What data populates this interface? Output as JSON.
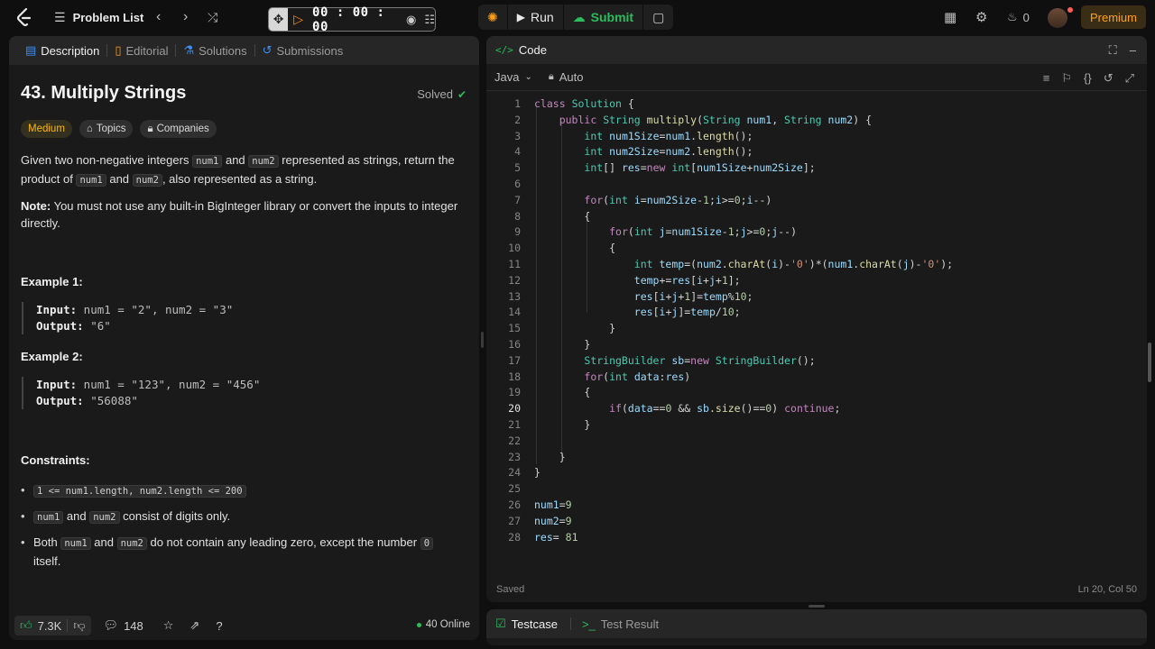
{
  "topbar": {
    "problem_list": "Problem List",
    "timer": "00 : 00 : 00",
    "run": "Run",
    "submit": "Submit",
    "streak_count": "0",
    "premium": "Premium"
  },
  "left": {
    "tabs": [
      "Description",
      "Editorial",
      "Solutions",
      "Submissions"
    ],
    "title": "43. Multiply Strings",
    "solved": "Solved",
    "chips": [
      "Medium",
      "Topics",
      "Companies"
    ],
    "desc1": {
      "a": "Given two non-negative integers ",
      "c1": "num1",
      "b": " and ",
      "c2": "num2",
      "d": " represented as strings, return the",
      "e": "product of ",
      "c3": "num1",
      "f": " and ",
      "c4": "num2",
      "g": ", also represented as a string."
    },
    "note_label": "Note:",
    "note_text": " You must not use any built-in BigInteger library or convert the inputs to integer directly.",
    "example1_title": "Example 1:",
    "example1_input_label": "Input:",
    "example1_input": " num1 = \"2\", num2 = \"3\"",
    "example1_output_label": "Output:",
    "example1_output": " \"6\"",
    "example2_title": "Example 2:",
    "example2_input_label": "Input:",
    "example2_input": " num1 = \"123\", num2 = \"456\"",
    "example2_output_label": "Output:",
    "example2_output": " \"56088\"",
    "constraints_title": "Constraints:",
    "constraint1": "1 <= num1.length, num2.length <= 200",
    "constraint2": {
      "c1": "num1",
      "a": " and ",
      "c2": "num2",
      "b": " consist of digits only."
    },
    "constraint3": {
      "a": "Both ",
      "c1": "num1",
      "b": " and ",
      "c2": "num2",
      "c": " do not contain any leading zero, except the number ",
      "c3": "0",
      "d": "itself."
    },
    "footer": {
      "likes": "7.3K",
      "comments": "148",
      "online": "40 Online"
    }
  },
  "code": {
    "header": "Code",
    "language": "Java",
    "mode": "Auto",
    "status_left": "Saved",
    "status_right": "Ln 20, Col 50",
    "line_numbers": [
      "1",
      "2",
      "3",
      "4",
      "5",
      "6",
      "7",
      "8",
      "9",
      "10",
      "11",
      "12",
      "13",
      "14",
      "15",
      "16",
      "17",
      "18",
      "19",
      "20",
      "21",
      "22",
      "23",
      "24",
      "25",
      "26",
      "27",
      "28"
    ],
    "current_line": "20",
    "lines": [
      "class Solution {",
      "    public String multiply(String num1, String num2) {",
      "        int num1Size=num1.length();",
      "        int num2Size=num2.length();",
      "        int[] res=new int[num1Size+num2Size];",
      "",
      "        for(int i=num2Size-1;i>=0;i--)",
      "        {",
      "            for(int j=num1Size-1;j>=0;j--)",
      "            {",
      "                int temp=(num2.charAt(i)-'0')*(num1.charAt(j)-'0');",
      "                temp+=res[i+j+1];",
      "                res[i+j+1]=temp%10;",
      "                res[i+j]=temp/10;",
      "            }",
      "        }",
      "        StringBuilder sb=new StringBuilder();",
      "        for(int data:res)",
      "        {",
      "            if(data==0 && sb.size()==0) continue;",
      "        }",
      "",
      "    }",
      "}",
      "",
      "num1=9",
      "num2=9",
      "res= 81"
    ]
  },
  "test": {
    "tabs": [
      "Testcase",
      "Test Result"
    ]
  },
  "colors": {
    "accent_orange": "#ffa116",
    "success_green": "#2cbb5d",
    "medium_yellow": "#ffb800"
  }
}
